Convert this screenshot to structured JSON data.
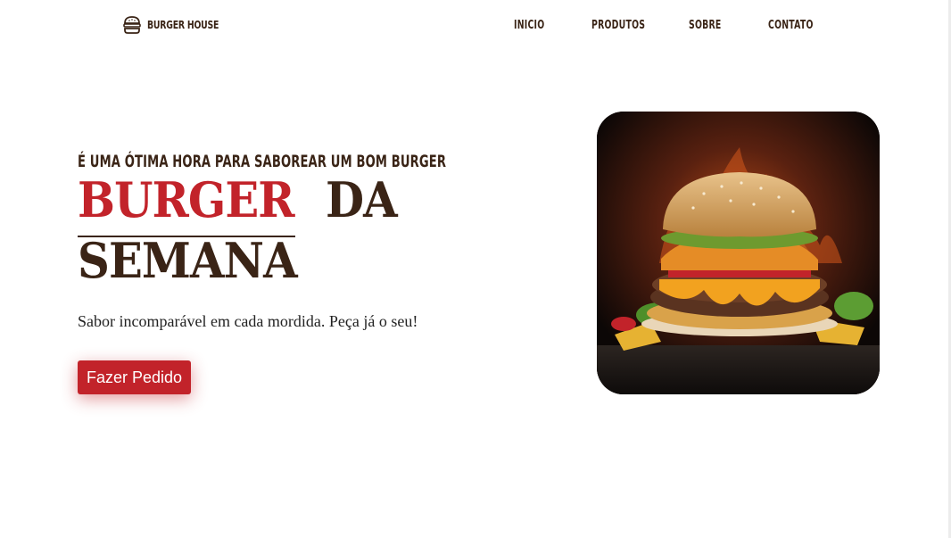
{
  "header": {
    "brand": "BURGER HOUSE",
    "nav": [
      "INICIO",
      "PRODUTOS",
      "SOBRE",
      "CONTATO"
    ]
  },
  "hero": {
    "eyebrow": "É UMA ÓTIMA HORA PARA SABOREAR UM BOM BURGER",
    "title_red": "BURGER",
    "title_dark": "DA",
    "title_line2": "SEMANA",
    "subtitle": "Sabor incomparável em cada mordida. Peça já o seu!",
    "cta_label": "Fazer Pedido"
  },
  "colors": {
    "accent": "#c2232a",
    "text_dark": "#3a2416",
    "background": "#ffffff"
  },
  "icons": {
    "logo": "burger-icon"
  }
}
